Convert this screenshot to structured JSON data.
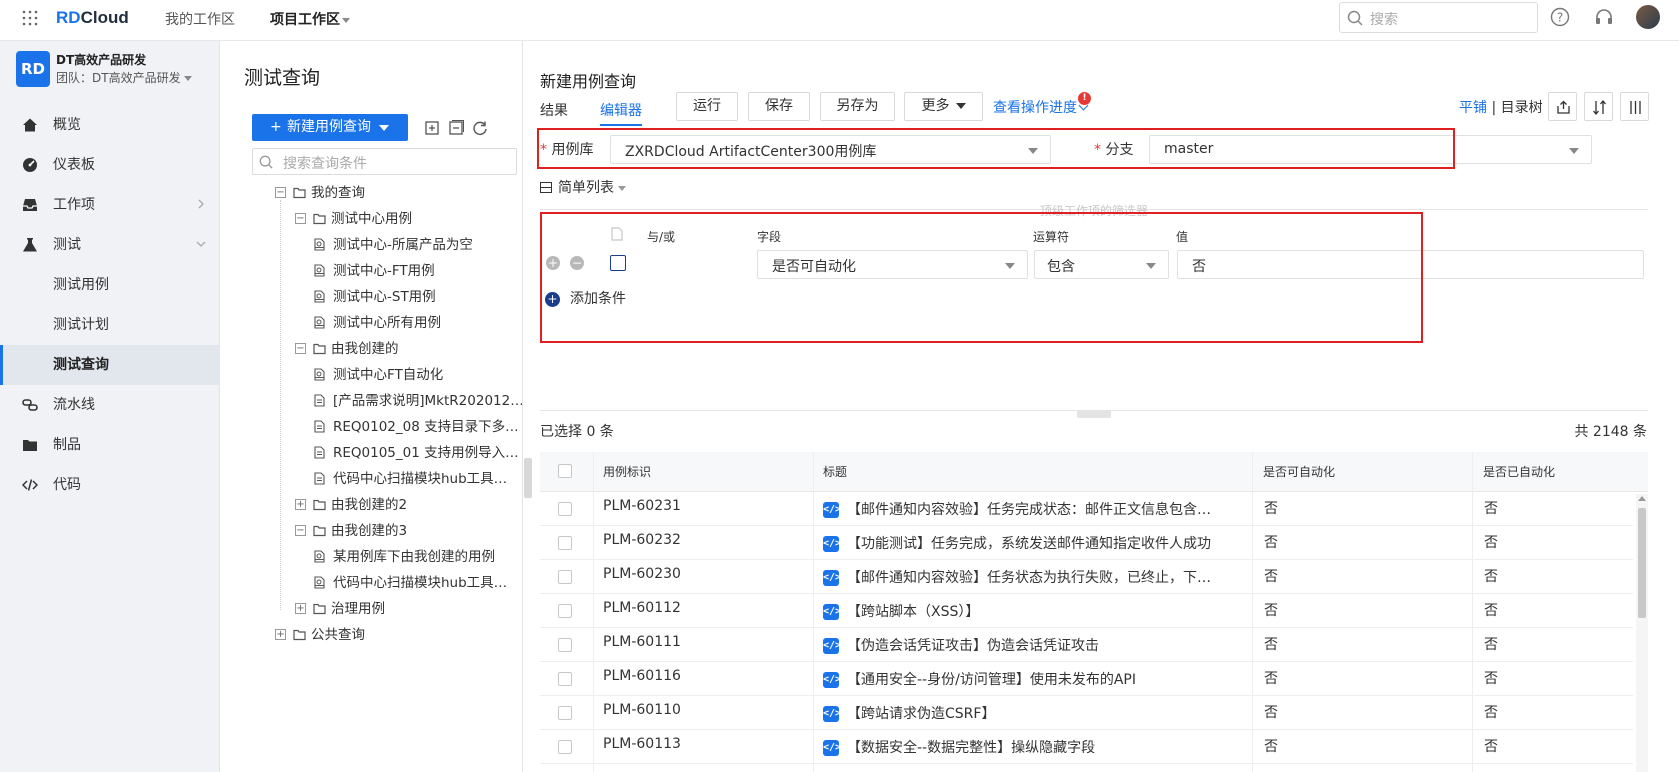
{
  "topbar": {
    "logo_rd": "RD",
    "logo_cloud": "Cloud",
    "nav_my": "我的工作区",
    "nav_project": "项目工作区",
    "search_placeholder": "搜索"
  },
  "sidebar": {
    "team_badge": "RD",
    "team_name": "DT高效产品研发",
    "team_sub": "团队：DT高效产品研发",
    "items": [
      {
        "label": "概览",
        "icon": "home-icon"
      },
      {
        "label": "仪表板",
        "icon": "dashboard-icon"
      },
      {
        "label": "工作项",
        "icon": "inbox-icon"
      },
      {
        "label": "测试",
        "icon": "flask-icon"
      },
      {
        "label": "测试用例",
        "icon": ""
      },
      {
        "label": "测试计划",
        "icon": ""
      },
      {
        "label": "测试查询",
        "icon": ""
      },
      {
        "label": "流水线",
        "icon": "pipeline-icon"
      },
      {
        "label": "制品",
        "icon": "package-icon"
      },
      {
        "label": "代码",
        "icon": "code-icon"
      }
    ]
  },
  "query_panel": {
    "title": "测试查询",
    "new_button": "新建用例查询",
    "search_placeholder": "搜索查询条件",
    "tree": [
      {
        "label": "我的查询",
        "type": "folder",
        "toggle": "−"
      },
      {
        "label": "测试中心用例",
        "type": "folder",
        "toggle": "−"
      },
      {
        "label": "测试中心-所属产品为空",
        "type": "query"
      },
      {
        "label": "测试中心-FT用例",
        "type": "query"
      },
      {
        "label": "测试中心-ST用例",
        "type": "query"
      },
      {
        "label": "测试中心所有用例",
        "type": "query"
      },
      {
        "label": "由我创建的",
        "type": "folder",
        "toggle": "−"
      },
      {
        "label": "测试中心FT自动化",
        "type": "query"
      },
      {
        "label": "[产品需求说明]MktR202012…",
        "type": "doc"
      },
      {
        "label": "REQ0102_08 支持目录下多…",
        "type": "doc"
      },
      {
        "label": "REQ0105_01 支持用例导入…",
        "type": "doc"
      },
      {
        "label": "代码中心扫描模块hub工具…",
        "type": "doc"
      },
      {
        "label": "由我创建的2",
        "type": "folder",
        "toggle": "+"
      },
      {
        "label": "由我创建的3",
        "type": "folder",
        "toggle": "−"
      },
      {
        "label": "某用例库下由我创建的用例",
        "type": "query"
      },
      {
        "label": "代码中心扫描模块hub工具…",
        "type": "query"
      },
      {
        "label": "治理用例",
        "type": "folder",
        "toggle": "+"
      },
      {
        "label": "公共查询",
        "type": "folder",
        "toggle": "+"
      }
    ]
  },
  "editor": {
    "title": "新建用例查询",
    "tab_result": "结果",
    "tab_editor": "编辑器",
    "btn_run": "运行",
    "btn_save": "保存",
    "btn_saveas": "另存为",
    "btn_more": "更多",
    "progress_link": "查看操作进度",
    "badge": "!",
    "view_flat": "平铺",
    "view_sep": " | ",
    "view_tree": "目录树",
    "library_label": "用例库",
    "library_value": "ZXRDCloud ArtifactCenter300用例库",
    "branch_label": "分支",
    "branch_value": "master",
    "list_mode": "简单列表",
    "ghost_text": "顶级工作项的筛选器",
    "col_andor": "与/或",
    "col_field": "字段",
    "col_operator": "运算符",
    "col_value": "值",
    "cond_field": "是否可自动化",
    "cond_operator": "包含",
    "cond_value": "否",
    "add_condition": "添加条件"
  },
  "results": {
    "selected": "已选择 0 条",
    "total": "共 2148 条",
    "headers": [
      "用例标识",
      "标题",
      "是否可自动化",
      "是否已自动化"
    ],
    "rows": [
      {
        "id": "PLM-60231",
        "title": "【邮件通知内容效验】任务完成状态：邮件正文信息包含…",
        "can_auto": "否",
        "is_auto": "否"
      },
      {
        "id": "PLM-60232",
        "title": "【功能测试】任务完成，系统发送邮件通知指定收件人成功",
        "can_auto": "否",
        "is_auto": "否"
      },
      {
        "id": "PLM-60230",
        "title": "【邮件通知内容效验】任务状态为执行失败，已终止，下…",
        "can_auto": "否",
        "is_auto": "否"
      },
      {
        "id": "PLM-60112",
        "title": "【跨站脚本（XSS）】",
        "can_auto": "否",
        "is_auto": "否"
      },
      {
        "id": "PLM-60111",
        "title": "【伪造会话凭证攻击】伪造会话凭证攻击",
        "can_auto": "否",
        "is_auto": "否"
      },
      {
        "id": "PLM-60116",
        "title": "【通用安全--身份/访问管理】使用未发布的API",
        "can_auto": "否",
        "is_auto": "否"
      },
      {
        "id": "PLM-60110",
        "title": "【跨站请求伪造CSRF】",
        "can_auto": "否",
        "is_auto": "否"
      },
      {
        "id": "PLM-60113",
        "title": "【数据安全--数据完整性】操纵隐藏字段",
        "can_auto": "否",
        "is_auto": "否"
      }
    ]
  }
}
